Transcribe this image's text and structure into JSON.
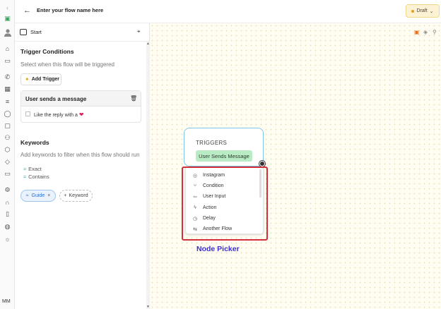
{
  "header": {
    "flow_name": "Enter your flow name here",
    "status": "Draft"
  },
  "user": {
    "initials": "MM"
  },
  "panel": {
    "start_label": "Start",
    "trigger_conditions": {
      "title": "Trigger Conditions",
      "subtitle": "Select when this flow will be triggered",
      "add_button": "Add Trigger",
      "card": {
        "title": "User sends a message",
        "checkbox_label": "Like the reply with a",
        "checkbox_checked": false
      }
    },
    "keywords": {
      "title": "Keywords",
      "subtitle": "Add keywords to filter when this flow should run",
      "match_types": [
        "Exact",
        "Contains"
      ],
      "chips": [
        {
          "label": "Guide"
        }
      ],
      "add_chip": "Keyword"
    }
  },
  "canvas": {
    "node": {
      "title": "TRIGGERS",
      "trigger": "User Sends Message"
    },
    "picker": {
      "items": [
        {
          "label": "Instagram",
          "icon": "instagram-icon"
        },
        {
          "label": "Condition",
          "icon": "branch-icon"
        },
        {
          "label": "User Input",
          "icon": "input-icon"
        },
        {
          "label": "Action",
          "icon": "bolt-icon"
        },
        {
          "label": "Delay",
          "icon": "clock-icon"
        },
        {
          "label": "Another Flow",
          "icon": "flow-icon"
        }
      ]
    },
    "annotation": "Node Picker"
  },
  "colors": {
    "accent_red": "#d32f3a",
    "annotation_blue": "#3b30c9",
    "trigger_green": "#b9ebc4",
    "draft_bg": "#fdf2d3"
  }
}
